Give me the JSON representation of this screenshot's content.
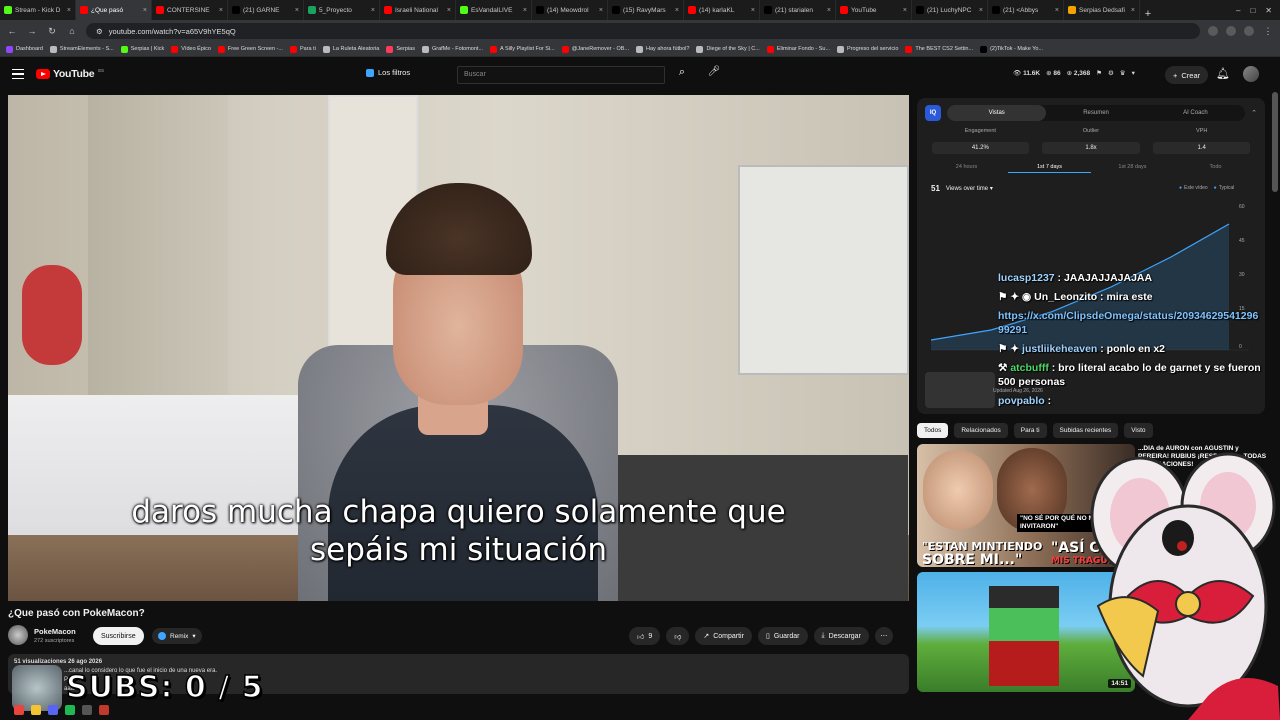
{
  "browser": {
    "tabs": [
      {
        "label": "Stream - Kick D",
        "color": "#53fc18"
      },
      {
        "label": "¿Que pasó",
        "color": "#ff0000",
        "active": true
      },
      {
        "label": "CONTERSINE",
        "color": "#ff0000"
      },
      {
        "label": "(21) GARNE",
        "color": "#000000"
      },
      {
        "label": "5_Proyecto",
        "color": "#1aa260"
      },
      {
        "label": "Israeli National",
        "color": "#ff0000"
      },
      {
        "label": "EsVandalLIVE",
        "color": "#53fc18"
      },
      {
        "label": "(14) Meowdrol",
        "color": "#000000"
      },
      {
        "label": "(15) RavyMars",
        "color": "#000000"
      },
      {
        "label": "(14) karlaKL",
        "color": "#ff0000"
      },
      {
        "label": "(21) starialen",
        "color": "#000000"
      },
      {
        "label": "YouTube",
        "color": "#ff0000"
      },
      {
        "label": "(21) LuchyNPC",
        "color": "#000000"
      },
      {
        "label": "(21) <Abbys",
        "color": "#000000"
      },
      {
        "label": "Serpias Dedsafi",
        "color": "#f4a300"
      }
    ],
    "new_tab": "+",
    "url": "youtube.com/watch?v=a65V9hYE5qQ",
    "bookmarks": [
      {
        "label": "Dashboard",
        "color": "#9146ff"
      },
      {
        "label": "StreamElements - S...",
        "color": "#bbbbbb"
      },
      {
        "label": "Serpias | Kick",
        "color": "#53fc18"
      },
      {
        "label": "Vídeo Épico",
        "color": "#ff0000"
      },
      {
        "label": "Free Green Screen -...",
        "color": "#ff0000"
      },
      {
        "label": "Para ti",
        "color": "#ff0000"
      },
      {
        "label": "La Ruleta Aleatoria",
        "color": "#bbbbbb"
      },
      {
        "label": "Serpias",
        "color": "#ff3b5c"
      },
      {
        "label": "GrafMe - Fotomont...",
        "color": "#bbbbbb"
      },
      {
        "label": "A Silly Playlist For Si...",
        "color": "#ff0000"
      },
      {
        "label": "@JaneRemover - OB...",
        "color": "#ff0000"
      },
      {
        "label": "Hay ahora fútbol?",
        "color": "#bbbbbb"
      },
      {
        "label": "Diege of the Sky | C...",
        "color": "#bbbbbb"
      },
      {
        "label": "Eliminar Fondo - Su...",
        "color": "#ff0000"
      },
      {
        "label": "Progreso del servicio",
        "color": "#bbbbbb"
      },
      {
        "label": "The BEST CS2 Settin...",
        "color": "#ff0000"
      },
      {
        "label": "(2)TikTok - Make Yo...",
        "color": "#000000"
      }
    ]
  },
  "youtube": {
    "logo_text": "YouTube",
    "logo_country": "ES",
    "filters_label": "Los filtros",
    "search_placeholder": "Buscar",
    "stats": {
      "a": "11.6K",
      "b": "86",
      "c": "2,368"
    },
    "create_label": "Crear"
  },
  "video": {
    "subtitle_line1": "daros mucha chapa quiero solamente que",
    "subtitle_line2": "sepáis mi situación",
    "title": "¿Que pasó con PokeMacon?",
    "channel": "PokeMacon",
    "subscribers": "272 suscriptores",
    "subscribe_label": "Suscribirse",
    "remix_label": "Remix",
    "likes": "9",
    "share_label": "Compartir",
    "save_label": "Guardar",
    "download_label": "Descargar",
    "views_date": "51 visualizaciones  26 ago 2026",
    "description": "...canal lo considero lo que fue el inicio de una nueva era.",
    "desc_line2": "Podr...",
    "desc_line3": "aaa..."
  },
  "overlay": {
    "subs_counter": "SUBS: 0 / 5"
  },
  "analytics": {
    "logo": "IQ",
    "tabs": [
      "Vistas",
      "Resumen",
      "AI Coach"
    ],
    "metrics": [
      {
        "label": "Engagement",
        "value": "41.2%"
      },
      {
        "label": "Outlier",
        "value": "1.8x"
      },
      {
        "label": "VPH",
        "value": "1.4"
      }
    ],
    "ranges": [
      "24 hours",
      "1st 7 days",
      "1st 28 days",
      "Todo"
    ],
    "views_count": "51",
    "views_label": "Views over time",
    "legend": [
      "Este vídeo",
      "Typical"
    ],
    "y_ticks": [
      "60",
      "45",
      "30",
      "15",
      "0"
    ],
    "x_ticks": [
      "0",
      "20"
    ],
    "uploaded": "Updated Aug 26, 2026"
  },
  "chat": [
    {
      "user": "lucasp1237",
      "text": " : JAAJAJJAJAJAA"
    },
    {
      "user": "Un_Leonzito",
      "text": " : mira este"
    },
    {
      "link": "https://x.com/ClipsdeOmega/status/2093462954129699291"
    },
    {
      "user": "justliikeheaven",
      "text": " : ponlo en x2"
    },
    {
      "user": "atcbufff",
      "text": " : bro literal acabo lo de garnet y se fueron 500 personas"
    },
    {
      "user": "povpablo",
      "text": " :"
    }
  ],
  "recommendations": {
    "chips": [
      "Todos",
      "Relacionados",
      "Para ti",
      "Subidas recientes",
      "Visto"
    ],
    "item1": {
      "title": "...DIA de AURON con AGUSTIN y PEREIRA! RUBIUS ¡RESPONDE a TODAS s ACUSACIONES!",
      "meta_channel": "rbiuS",
      "meta_stats": "12 K  hace 22 h",
      "thumb_line1": "\"ESTAN MINTIENDO",
      "thumb_line2": "SOBRE MI...\"",
      "thumb_right": "\"ASÍ CU...",
      "thumb_quote": "\"NO SÉ POR QUÉ NO ME INVITARON\"",
      "thumb_tag": "MIS TRAGU...",
      "duration": "33:21"
    },
    "item2": {
      "duration": "14:51"
    }
  }
}
